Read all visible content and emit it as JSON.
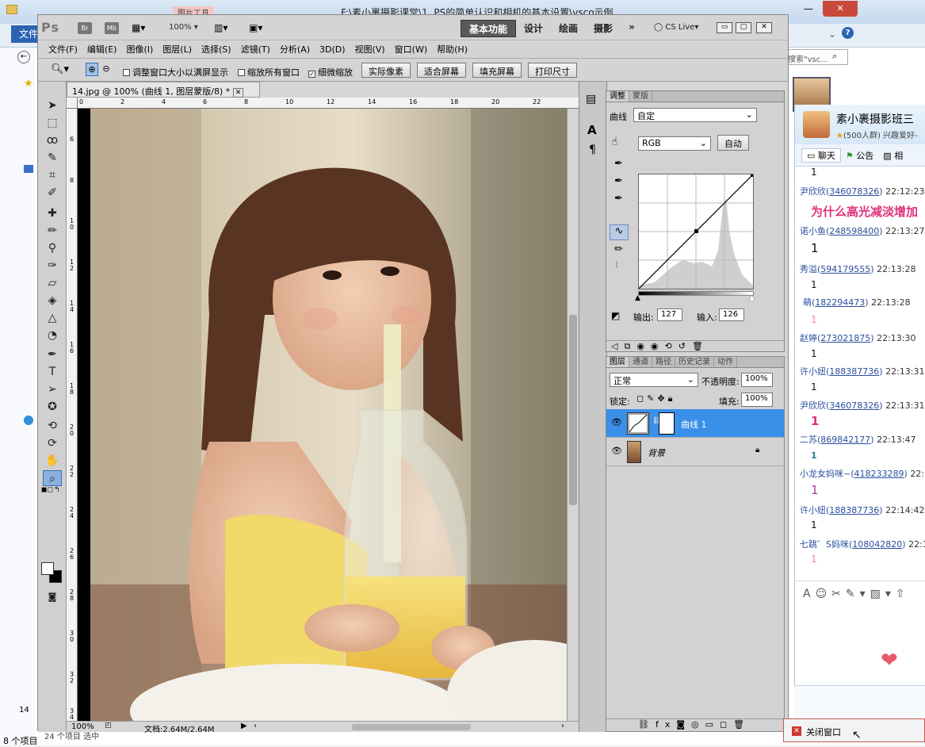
{
  "explorer": {
    "title": "F:\\素小裹摄影课堂\\1. PS的简单认识和相机的基本设置\\vsco示例",
    "picture_tools_label": "图片工具",
    "file_tab": "文件",
    "search_placeholder": "搜索\"vsc...",
    "status_items": "8 个项目",
    "status_selected": "24 个项目    选中",
    "status_count": "14"
  },
  "ps": {
    "logo": "Ps",
    "bridge": "Br",
    "minibridge": "Mb",
    "zoom_top": "100%",
    "workspaces": [
      "基本功能",
      "设计",
      "绘画",
      "摄影"
    ],
    "more": "»",
    "cs_live": "CS Live",
    "menu": [
      "文件(F)",
      "编辑(E)",
      "图像(I)",
      "图层(L)",
      "选择(S)",
      "滤镜(T)",
      "分析(A)",
      "3D(D)",
      "视图(V)",
      "窗口(W)",
      "帮助(H)"
    ],
    "options": {
      "resize_windows": "调整窗口大小以满屏显示",
      "zoom_all": "缩放所有窗口",
      "scrubby_zoom": "细微缩放",
      "scrubby_checked": true,
      "btn_actual": "实际像素",
      "btn_fit": "适合屏幕",
      "btn_fill": "填充屏幕",
      "btn_print": "打印尺寸"
    },
    "document": {
      "tab_title": "14.jpg @ 100% (曲线 1, 图层蒙版/8) *",
      "ruler_h": [
        "0",
        "2",
        "4",
        "6",
        "8",
        "10",
        "12",
        "14",
        "16",
        "18",
        "20",
        "22"
      ],
      "ruler_v": [
        "6",
        "8",
        "10",
        "12",
        "14",
        "16",
        "18",
        "20",
        "22",
        "24",
        "26",
        "28",
        "30",
        "32",
        "34"
      ],
      "zoom": "100%",
      "doc_size": "文档:2.64M/2.64M"
    },
    "adjustments": {
      "tab_adjust": "调整",
      "tab_masks": "蒙版",
      "curve_label": "曲线",
      "preset": "自定",
      "channel": "RGB",
      "auto": "自动",
      "output_label": "输出:",
      "output_value": "127",
      "input_label": "输入:",
      "input_value": "126"
    },
    "layers": {
      "tabs": [
        "图层",
        "通道",
        "路径",
        "历史记录",
        "动作"
      ],
      "blend_mode": "正常",
      "opacity_label": "不透明度:",
      "opacity_value": "100%",
      "lock_label": "锁定:",
      "fill_label": "填充:",
      "fill_value": "100%",
      "items": [
        {
          "name": "曲线 1",
          "selected": true
        },
        {
          "name": "背景",
          "selected": false
        }
      ]
    }
  },
  "qq": {
    "group_name": "素小裹摄影班三",
    "group_sub": "(500人群) 兴趣爱好-",
    "tabs": [
      "聊天",
      "公告",
      "相"
    ],
    "messages": [
      {
        "user": "",
        "id": "",
        "time": "",
        "text": "1",
        "style": "normal"
      },
      {
        "user": "尹欣欣",
        "id": "346078326",
        "time": "22:12:23",
        "text": "为什么高光减淡增加",
        "style": "big-pink"
      },
      {
        "user": "诺小鱼",
        "id": "248598400",
        "time": "22:13:27",
        "text": "1",
        "style": "large"
      },
      {
        "user": "秀溢",
        "id": "594179555",
        "time": "22:13:28",
        "text": "1",
        "style": "normal"
      },
      {
        "user": "萌",
        "id": "182294473",
        "time": "22:13:28",
        "text": "1",
        "style": "light-pink"
      },
      {
        "user": "赵婷",
        "id": "273021875",
        "time": "22:13:30",
        "text": "1",
        "style": "normal"
      },
      {
        "user": "许小妞",
        "id": "188387736",
        "time": "22:13:31",
        "text": "1",
        "style": "normal"
      },
      {
        "user": "尹欣欣",
        "id": "346078326",
        "time": "22:13:31",
        "text": "1",
        "style": "pink-bold"
      },
      {
        "user": "二苏",
        "id": "869842177",
        "time": "22:13:47",
        "text": "1",
        "style": "teal"
      },
      {
        "user": "小龙女妈咪~",
        "id": "418233289",
        "time": "22:1",
        "text": "1",
        "style": "purple"
      },
      {
        "user": "许小妞",
        "id": "188387736",
        "time": "22:14:42",
        "text": "1",
        "style": "normal"
      },
      {
        "user": "七跳゛S妈咪",
        "id": "108042820",
        "time": "22:1",
        "text": "1",
        "style": "light-pink"
      }
    ],
    "close_window": "关闭窗口"
  }
}
